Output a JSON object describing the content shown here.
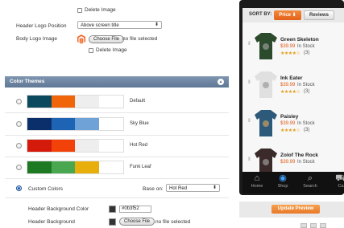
{
  "logo_settings": {
    "delete_image_label_1": "Delete Image",
    "header_logo_position_label": "Header Logo Position",
    "header_logo_position_value": "Above screen title",
    "body_logo_image_label": "Body Logo Image",
    "choose_file_label": "Choose File",
    "no_file_label": "no file selected",
    "delete_image_label_2": "Delete Image"
  },
  "color_themes": {
    "title": "Color Themes",
    "themes": [
      {
        "name": "Default",
        "colors": [
          "#0b4a5e",
          "#f0640a",
          "#eeeeee",
          "#ffffff"
        ]
      },
      {
        "name": "Sky Blue",
        "colors": [
          "#0b2f6b",
          "#1e64b4",
          "#6fa3d8",
          "#ffffff"
        ]
      },
      {
        "name": "Hot Red",
        "colors": [
          "#d41a0a",
          "#f2420a",
          "#eeeeee",
          "#ffffff"
        ]
      },
      {
        "name": "Funk Leaf",
        "colors": [
          "#1d7a23",
          "#49a84f",
          "#e8ae0c",
          "#ffffff"
        ]
      }
    ],
    "custom_colors_label": "Custom Colors",
    "base_on_label": "Base on:",
    "base_on_value": "Hot Red",
    "header_bg_color_label": "Header Background Color",
    "header_bg_color_value": "#0b3f52",
    "header_bg_label": "Header Background",
    "choose_file_label": "Choose File",
    "no_file_label": "no file selected"
  },
  "preview": {
    "sort_by_label": "SORT BY:",
    "price_button": "Price ⬇",
    "reviews_button": "Reviews",
    "products": [
      {
        "title": "Green Skeleton",
        "price": "$39.99",
        "stock": "In Stock",
        "count": "(3)"
      },
      {
        "title": "Ink Eater",
        "price": "$39.99",
        "stock": "In Stock",
        "count": "(3)"
      },
      {
        "title": "Paisley",
        "price": "$39.99",
        "stock": "In Stock",
        "count": "(3)"
      },
      {
        "title": "Zolof The Rock",
        "price": "$39.99",
        "stock": "In Stock",
        "count": ""
      }
    ],
    "nav": [
      "Home",
      "Shop",
      "Search",
      "Ca"
    ],
    "update_button": "Update Preview"
  },
  "colors": {
    "accent_orange": "#e8792a",
    "section_header_blue": "#6a819e",
    "star_gold": "#e49b12"
  }
}
